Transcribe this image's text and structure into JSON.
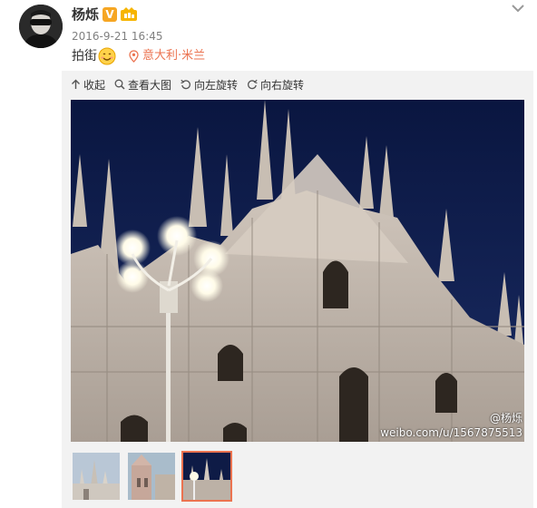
{
  "post": {
    "username": "杨烁",
    "verified_badge": "V",
    "rank_badge_icon": "member-badge-icon",
    "timestamp": "2016-9-21 16:45",
    "text": "拍街",
    "text_emoji_icon": "smiling-face-emoji-icon",
    "location": "意大利·米兰",
    "menu_icon": "chevron-down-icon"
  },
  "toolbar": {
    "collapse_label": "收起",
    "view_large_label": "查看大图",
    "rotate_left_label": "向左旋转",
    "rotate_right_label": "向右旋转"
  },
  "photo": {
    "subject_icon": "milan-cathedral-night-photo",
    "watermark_user": "@杨烁",
    "watermark_url": "weibo.com/u/1567875513"
  },
  "thumbnails": [
    {
      "name": "thumbnail-1",
      "active": false
    },
    {
      "name": "thumbnail-2",
      "active": false
    },
    {
      "name": "thumbnail-3",
      "active": true
    }
  ],
  "colors": {
    "accent": "#eb7350",
    "sky": "#0b1840",
    "stone": "#d8d0c8"
  }
}
